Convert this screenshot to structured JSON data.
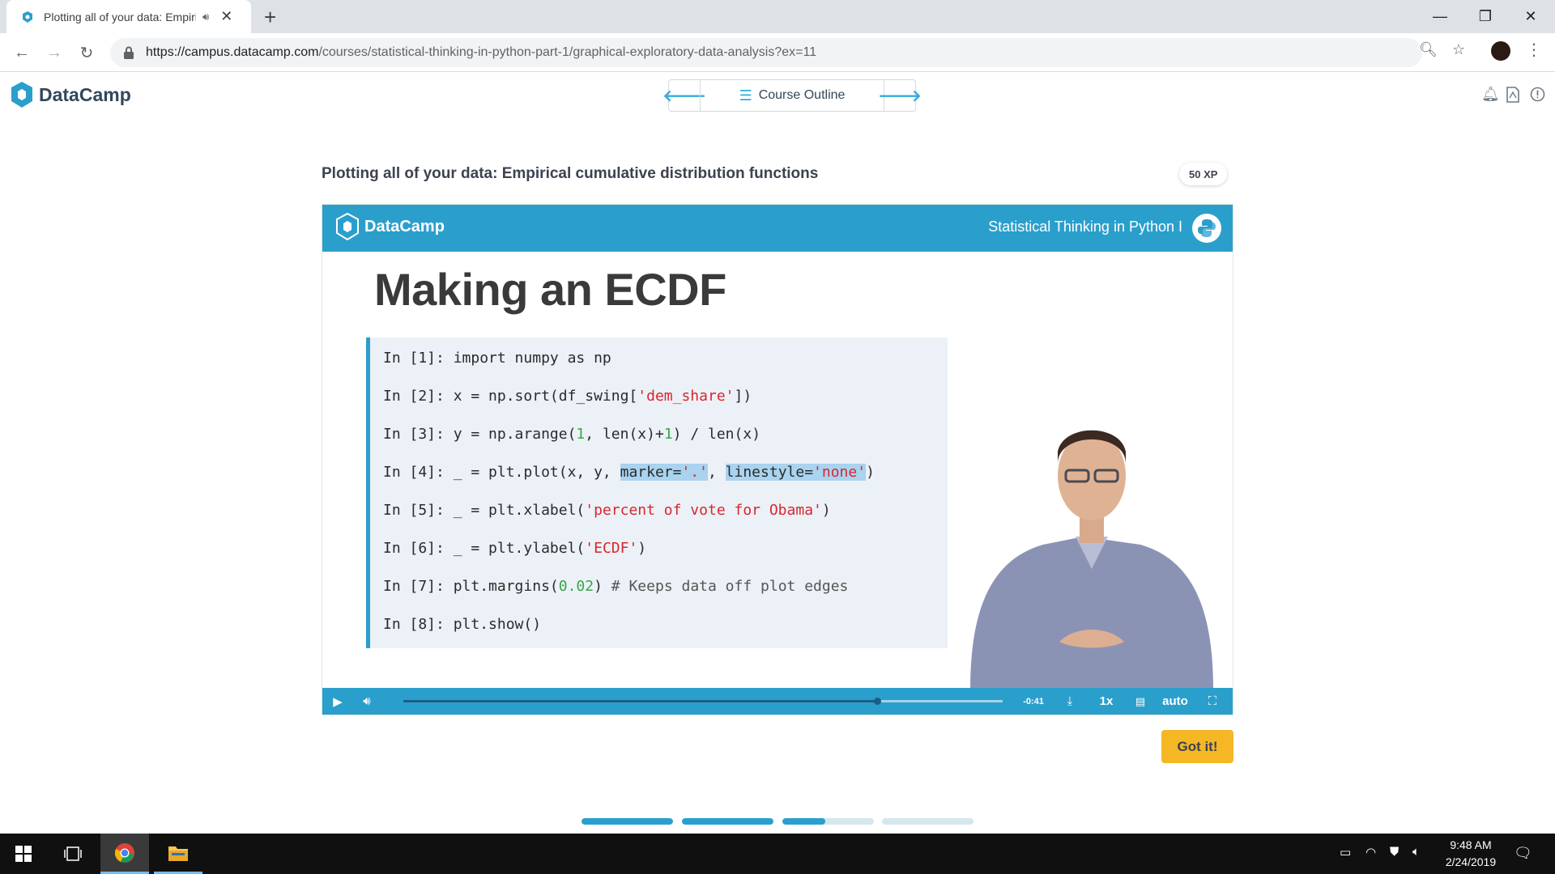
{
  "browser": {
    "tab_title": "Plotting all of your data: Empirical cumulative distribution functions",
    "url_host": "https://campus.datacamp.com",
    "url_path": "/courses/statistical-thinking-in-python-part-1/graphical-exploratory-data-analysis?ex=11"
  },
  "header": {
    "brand": "DataCamp",
    "outline_label": "Course Outline"
  },
  "exercise": {
    "title": "Plotting all of your data: Empirical cumulative distribution functions",
    "xp": "50 XP"
  },
  "slide": {
    "brand": "DataCamp",
    "course": "Statistical Thinking in Python I",
    "heading": "Making an ECDF",
    "code": [
      {
        "prompt": "In [1]: ",
        "code": "import numpy as np"
      },
      {
        "prompt": "In [2]: ",
        "code": "x = np.sort(df_swing['dem_share'])"
      },
      {
        "prompt": "In [3]: ",
        "code": "y = np.arange(1, len(x)+1) / len(x)"
      },
      {
        "prompt": "In [4]: ",
        "code": "_ = plt.plot(x, y, marker='.', linestyle='none')"
      },
      {
        "prompt": "In [5]: ",
        "code": "_ = plt.xlabel('percent of vote for Obama')"
      },
      {
        "prompt": "In [6]: ",
        "code": "_ = plt.ylabel('ECDF')"
      },
      {
        "prompt": "In [7]: ",
        "code": "plt.margins(0.02) # Keeps data off plot edges"
      },
      {
        "prompt": "In [8]: ",
        "code": "plt.show()"
      }
    ]
  },
  "player": {
    "time_remaining": "-0:41",
    "speed": "1x",
    "quality": "auto",
    "progress": 0.79
  },
  "actions": {
    "got_it": "Got it!"
  },
  "progress_steps": [
    1,
    1,
    0.47,
    0
  ],
  "taskbar": {
    "time": "9:48 AM",
    "date": "2/24/2019"
  },
  "colors": {
    "accent": "#2b9fcc",
    "button": "#f5b724",
    "string": "#d8262e",
    "number": "#3aa648"
  }
}
